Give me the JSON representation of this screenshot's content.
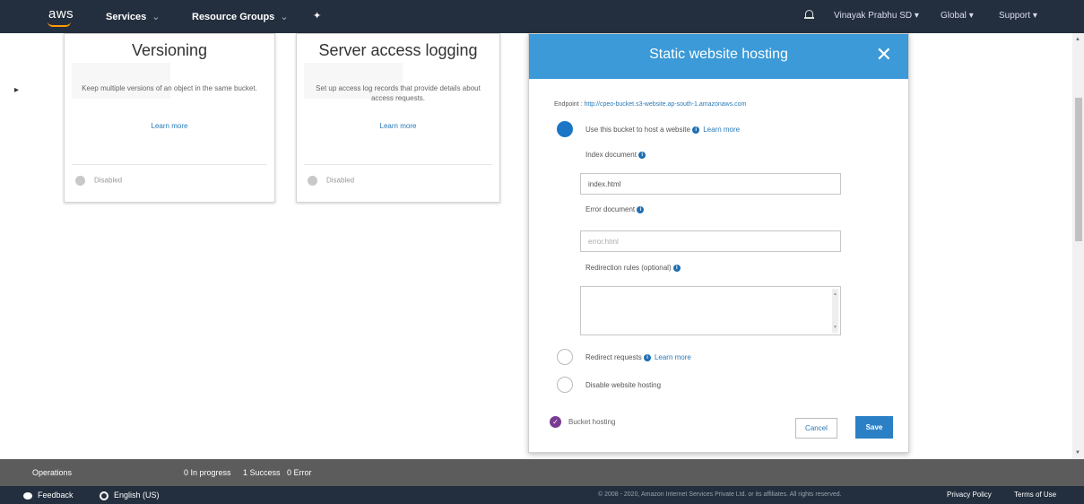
{
  "topnav": {
    "logo": "aws",
    "services": "Services",
    "resource_groups": "Resource Groups",
    "pin": "✦",
    "caret": "⌄",
    "user": "Vinayak Prabhu SD",
    "region": "Global",
    "support": "Support",
    "dropdown_caret": "▾"
  },
  "cards": {
    "versioning": {
      "title": "Versioning",
      "description": "Keep multiple versions of an object in the same bucket.",
      "link": "Learn more",
      "status": "Disabled"
    },
    "logging": {
      "title": "Server access logging",
      "description": "Set up access log records that provide details about access requests.",
      "link": "Learn more",
      "status": "Disabled"
    }
  },
  "modal": {
    "title": "Static website hosting",
    "close": "✕",
    "endpoint_label": "Endpoint :",
    "endpoint_url": "http://cpeo-bucket.s3-website.ap-south-1.amazonaws.com",
    "options": {
      "host": "Use this bucket to host a website",
      "redirect": "Redirect requests",
      "disable": "Disable website hosting",
      "learn_more": "Learn more"
    },
    "index_label": "Index document",
    "index_value": "index.html",
    "error_label": "Error document",
    "error_placeholder": "error.html",
    "redirection_label": "Redirection rules (optional)",
    "bucket_hosting": "Bucket hosting",
    "cancel": "Cancel",
    "save": "Save"
  },
  "operations": {
    "label": "Operations",
    "in_progress": "0 In progress",
    "success": "1 Success",
    "error": "0 Error"
  },
  "footer": {
    "feedback": "Feedback",
    "language": "English (US)",
    "copyright": "© 2008 - 2020, Amazon Internet Services Private Ltd. or its affiliates. All rights reserved.",
    "privacy": "Privacy Policy",
    "terms": "Terms of Use"
  }
}
